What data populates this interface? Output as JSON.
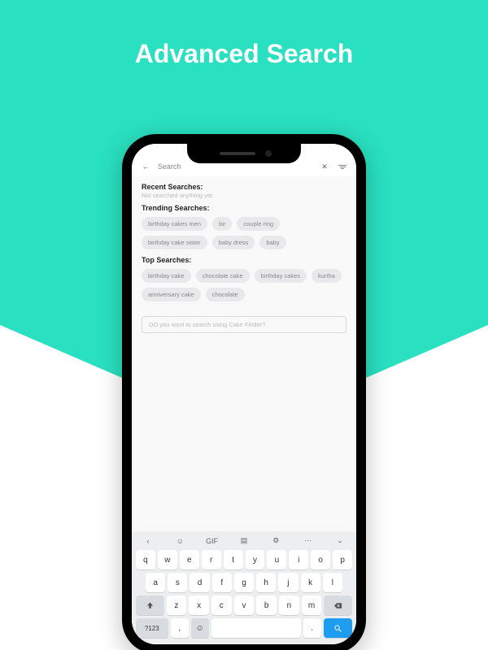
{
  "hero": {
    "title": "Advanced Search"
  },
  "header": {
    "search_placeholder": "Search",
    "back_glyph": "←",
    "close_glyph": "✕"
  },
  "recent": {
    "title": "Recent Searches:",
    "empty_text": "Not searched anything yet"
  },
  "trending": {
    "title": "Trending Searches:",
    "chips": [
      "birthday cakes men",
      "bir",
      "couple ring",
      "birthday cake sister",
      "baby dress",
      "baby"
    ]
  },
  "top": {
    "title": "Top Searches:",
    "chips": [
      "birthday cake",
      "chocolate cake",
      "birthday cakes",
      "kurtha",
      "anniversary cake",
      "chocolate"
    ]
  },
  "finder": {
    "text": "DO you want to search using Cake Finder?"
  },
  "keyboard": {
    "toolbar": {
      "gif_label": "GIF"
    },
    "row1": [
      "q",
      "w",
      "e",
      "r",
      "t",
      "y",
      "u",
      "i",
      "o",
      "p"
    ],
    "row2": [
      "a",
      "s",
      "d",
      "f",
      "g",
      "h",
      "j",
      "k",
      "l"
    ],
    "row3": [
      "z",
      "x",
      "c",
      "v",
      "b",
      "n",
      "m"
    ],
    "sym_label": "?123",
    "comma": ",",
    "dot": "."
  }
}
